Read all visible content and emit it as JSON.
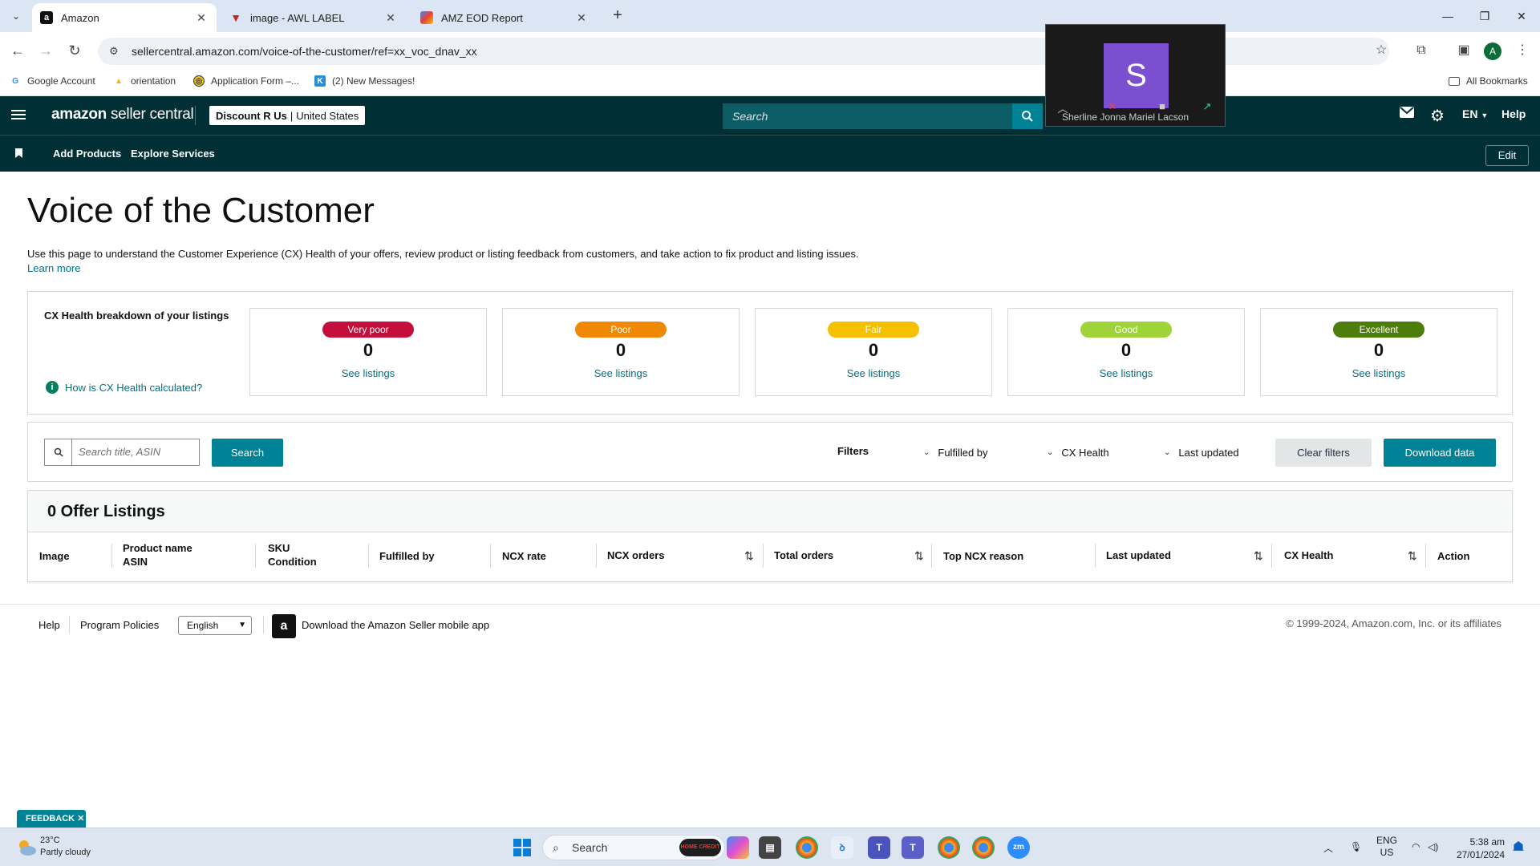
{
  "browser": {
    "tabs": [
      {
        "title": "Amazon",
        "favicon": "amazon-a-icon",
        "active": true
      },
      {
        "title": "image - AWL LABEL",
        "favicon": "awl-icon",
        "active": false
      },
      {
        "title": "AMZ EOD Report",
        "favicon": "report-icon",
        "active": false
      }
    ],
    "url": "sellercentral.amazon.com/voice-of-the-customer/ref=xx_voc_dnav_xx",
    "profile_initial": "A",
    "bookmarks": [
      {
        "label": "Google Account",
        "icon": "google-icon"
      },
      {
        "label": "orientation",
        "icon": "drive-icon"
      },
      {
        "label": "Application Form –...",
        "icon": "form-icon"
      },
      {
        "label": "(2) New Messages!",
        "icon": "k-icon"
      }
    ],
    "all_bookmarks": "All Bookmarks"
  },
  "zoom": {
    "avatar_letter": "S",
    "participant": "Sherline Jonna Mariel Lacson"
  },
  "header": {
    "logo_main": "amazon",
    "logo_sub": "seller central",
    "store_name": "Discount R Us",
    "store_region": "United States",
    "search_placeholder": "Search",
    "language": "EN",
    "help": "Help"
  },
  "subnav": {
    "links": [
      "Add Products",
      "Explore Services"
    ],
    "edit": "Edit"
  },
  "page": {
    "title": "Voice of the Customer",
    "description": "Use this page to understand the Customer Experience (CX) Health of your offers, review product or listing feedback from customers, and take action to fix product and listing issues.",
    "learn_more": "Learn more"
  },
  "cx_health": {
    "label": "CX Health breakdown of your listings",
    "how_link": "How is CX Health calculated?",
    "cards": [
      {
        "label": "Very poor",
        "count": "0",
        "link": "See listings",
        "color": "#c40f3c"
      },
      {
        "label": "Poor",
        "count": "0",
        "link": "See listings",
        "color": "#f08804"
      },
      {
        "label": "Fair",
        "count": "0",
        "link": "See listings",
        "color": "#f5c000"
      },
      {
        "label": "Good",
        "count": "0",
        "link": "See listings",
        "color": "#9fd33a"
      },
      {
        "label": "Excellent",
        "count": "0",
        "link": "See listings",
        "color": "#4d7d0b"
      }
    ]
  },
  "filters": {
    "search_placeholder": "Search title, ASIN",
    "search_button": "Search",
    "filters_label": "Filters",
    "dropdowns": [
      "Fulfilled by",
      "CX Health",
      "Last updated"
    ],
    "clear": "Clear filters",
    "download": "Download data"
  },
  "table": {
    "title": "0 Offer Listings",
    "columns": [
      {
        "line1": "Image",
        "line2": ""
      },
      {
        "line1": "Product name",
        "line2": "ASIN"
      },
      {
        "line1": "SKU",
        "line2": "Condition"
      },
      {
        "line1": "Fulfilled by",
        "line2": ""
      },
      {
        "line1": "NCX rate",
        "line2": ""
      },
      {
        "line1": "NCX orders",
        "line2": ""
      },
      {
        "line1": "Total orders",
        "line2": ""
      },
      {
        "line1": "Top NCX reason",
        "line2": ""
      },
      {
        "line1": "Last updated",
        "line2": ""
      },
      {
        "line1": "CX Health",
        "line2": ""
      },
      {
        "line1": "Action",
        "line2": ""
      }
    ]
  },
  "footer": {
    "help": "Help",
    "policies": "Program Policies",
    "language": "English",
    "app_text": "Download the Amazon Seller mobile app",
    "copyright": "© 1999-2024, Amazon.com, Inc. or its affiliates"
  },
  "feedback": "FEEDBACK",
  "taskbar": {
    "temperature": "23°C",
    "weather": "Partly cloudy",
    "search": "Search",
    "search_badge": "HOME CREDIT",
    "lang_top": "ENG",
    "lang_bottom": "US",
    "time": "5:38 am",
    "date": "27/01/2024"
  }
}
